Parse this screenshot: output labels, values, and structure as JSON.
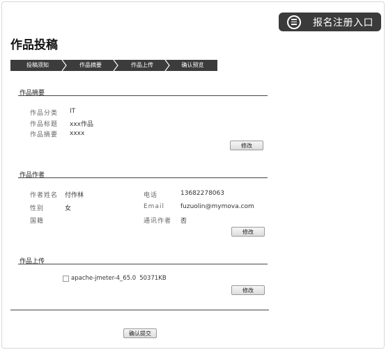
{
  "header": {
    "title": "作品投稿",
    "register_entry": "报名注册入口"
  },
  "steps": [
    "投稿须知",
    "作品摘要",
    "作品上传",
    "确认预览"
  ],
  "summary": {
    "title": "作品摘要",
    "rows": [
      {
        "label": "作品分类",
        "value": "IT"
      },
      {
        "label": "作品标题",
        "value": "xxx作品"
      },
      {
        "label": "作品摘要",
        "value": "xxxx"
      }
    ],
    "edit": "修改"
  },
  "authors": {
    "title": "作品作者",
    "name_label": "作者姓名",
    "name": "付作林",
    "gender_label": "性别",
    "gender": "女",
    "nationality_label": "国籍",
    "phone_label": "电话",
    "phone": "13682278063",
    "email_label": "Email",
    "email": "fuzuolin@mymova.com",
    "contact_label": "通讯作者",
    "contact": "否",
    "edit": "修改"
  },
  "upload": {
    "title": "作品上传",
    "file_name": "apache-jmeter-4_65.0",
    "file_size": "50371KB",
    "edit": "修改"
  },
  "confirm": "确认提交"
}
